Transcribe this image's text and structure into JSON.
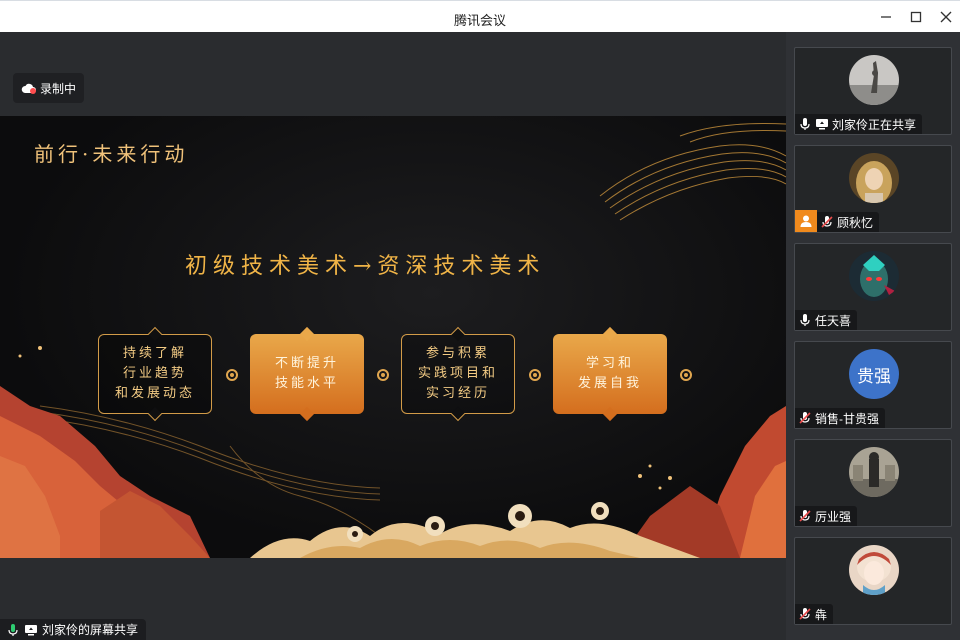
{
  "window": {
    "title": "腾讯会议",
    "minimize_icon": "minimize-icon",
    "maximize_icon": "maximize-icon",
    "close_icon": "close-icon"
  },
  "recording": {
    "label": "录制中",
    "icon": "cloud-record-icon",
    "color": "#ff4d4f"
  },
  "slide": {
    "title": "前行·未来行动",
    "headline": "初级技术美术→资深技术美术",
    "boxes": [
      {
        "lines": [
          "持续了解",
          "行业趋势",
          "和发展动态"
        ],
        "style": "outline"
      },
      {
        "lines": [
          "不断提升",
          "技能水平"
        ],
        "style": "filled"
      },
      {
        "lines": [
          "参与积累",
          "实践项目和",
          "实习经历"
        ],
        "style": "outline"
      },
      {
        "lines": [
          "学习和",
          "发展自我"
        ],
        "style": "filled"
      }
    ],
    "accent": "#e0a64f"
  },
  "screen_share": {
    "label": "刘家伶的屏幕共享",
    "mic_icon": "mic-on-icon",
    "screen_icon": "screen-share-icon"
  },
  "participants": [
    {
      "name": "刘家伶正在共享",
      "mic": "on",
      "sharing": true,
      "avatar": "photo"
    },
    {
      "name": "顾秋忆",
      "mic": "off",
      "host": true,
      "avatar": "photo"
    },
    {
      "name": "任天喜",
      "mic": "on",
      "avatar": "photo"
    },
    {
      "name": "销售-甘贵强",
      "mic": "off",
      "avatar": "text",
      "avatar_text": "贵强",
      "avatar_color": "#3d73c9"
    },
    {
      "name": "厉业强",
      "mic": "off",
      "avatar": "photo"
    },
    {
      "name": "犇",
      "mic": "off",
      "avatar": "photo"
    }
  ],
  "colors": {
    "mic_on": "#2ecc71",
    "mic_off": "#e84c4c",
    "host_badge": "#f08a1d"
  }
}
